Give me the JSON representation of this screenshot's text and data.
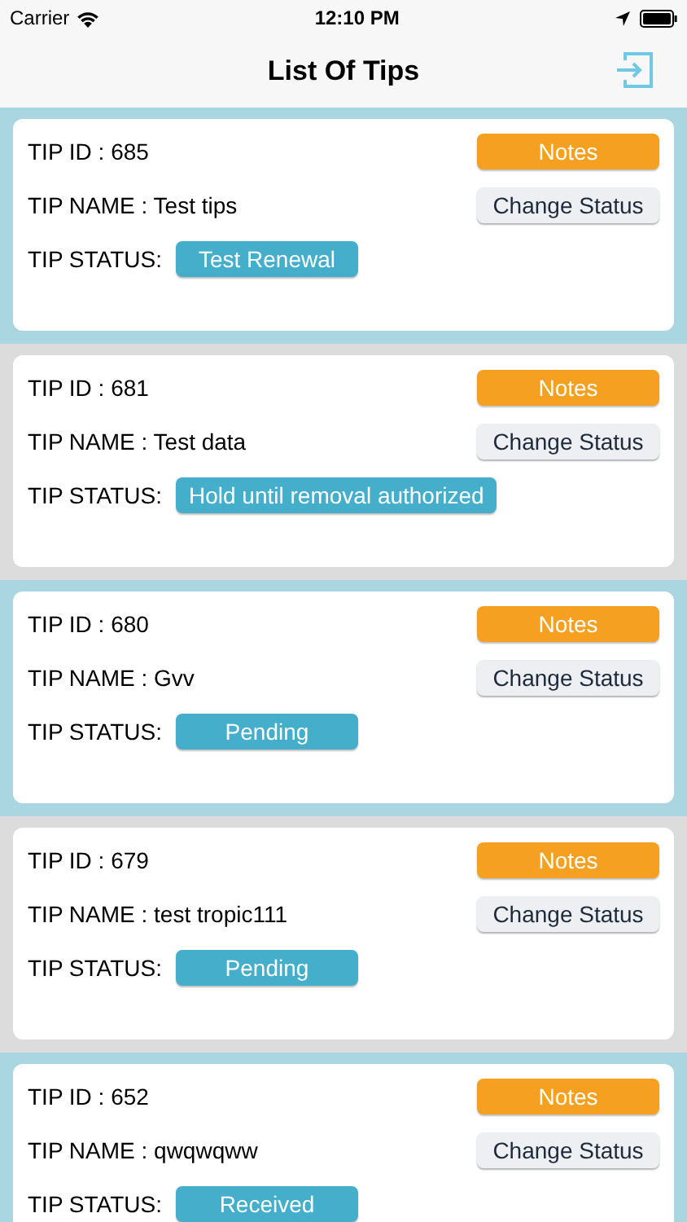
{
  "status_bar": {
    "carrier": "Carrier",
    "time": "12:10 PM"
  },
  "nav": {
    "title": "List Of Tips"
  },
  "tips": [
    {
      "id_label": "TIP ID : 685",
      "name_label": "TIP NAME : Test tips",
      "status_label": "TIP STATUS:",
      "status": "Test Renewal",
      "notes_button": "Notes",
      "change_button": "Change Status"
    },
    {
      "id_label": "TIP ID : 681",
      "name_label": "TIP NAME : Test data",
      "status_label": "TIP STATUS:",
      "status": "Hold until removal authorized",
      "notes_button": "Notes",
      "change_button": "Change Status"
    },
    {
      "id_label": "TIP ID : 680",
      "name_label": "TIP NAME : Gvv",
      "status_label": "TIP STATUS:",
      "status": "Pending",
      "notes_button": "Notes",
      "change_button": "Change Status"
    },
    {
      "id_label": "TIP ID : 679",
      "name_label": "TIP NAME : test tropic111",
      "status_label": "TIP STATUS:",
      "status": "Pending",
      "notes_button": "Notes",
      "change_button": "Change Status"
    },
    {
      "id_label": "TIP ID : 652",
      "name_label": "TIP NAME : qwqwqww",
      "status_label": "TIP STATUS:",
      "status": "Received",
      "notes_button": "Notes",
      "change_button": "Change Status"
    }
  ]
}
